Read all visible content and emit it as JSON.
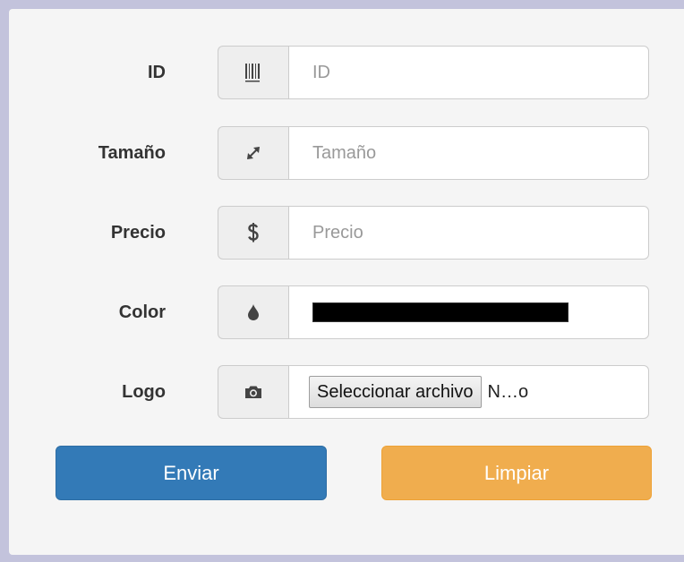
{
  "form": {
    "fields": [
      {
        "label": "ID",
        "placeholder": "ID",
        "icon": "barcode-icon"
      },
      {
        "label": "Tamaño",
        "placeholder": "Tamaño",
        "icon": "resize-icon"
      },
      {
        "label": "Precio",
        "placeholder": "Precio",
        "icon": "dollar-icon"
      },
      {
        "label": "Color",
        "value": "#000000",
        "icon": "tint-icon"
      },
      {
        "label": "Logo",
        "button": "Seleccionar archivo",
        "filename": "N…o",
        "icon": "camera-icon"
      }
    ],
    "submit_label": "Enviar",
    "reset_label": "Limpiar"
  },
  "colors": {
    "primary": "#337ab7",
    "warning": "#f0ad4e",
    "selected_color": "#000000"
  }
}
